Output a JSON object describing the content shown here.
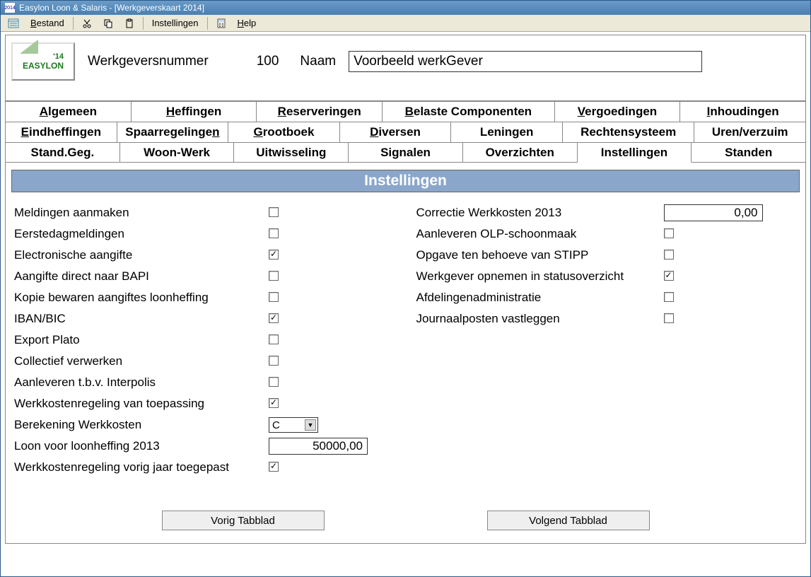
{
  "title": "Easylon Loon & Salaris - [Werkgeverskaart 2014]",
  "menu": {
    "bestand": "Bestand",
    "instellingen": "Instellingen",
    "help": "Help"
  },
  "logo": {
    "line1": "'14",
    "line2": "EASYLON"
  },
  "header": {
    "werkgeversnummer_label": "Werkgeversnummer",
    "werkgeversnummer_value": "100",
    "naam_label": "Naam",
    "naam_value": "Voorbeeld werkGever"
  },
  "tabs": {
    "row1": [
      "Algemeen",
      "Heffingen",
      "Reserveringen",
      "Belaste Componenten",
      "Vergoedingen",
      "Inhoudingen"
    ],
    "row2": [
      "Eindheffingen",
      "Spaarregelingen",
      "Grootboek",
      "Diversen",
      "Leningen",
      "Rechtensysteem",
      "Uren/verzuim"
    ],
    "row3": [
      "Stand.Geg.",
      "Woon-Werk",
      "Uitwisseling",
      "Signalen",
      "Overzichten",
      "Instellingen",
      "Standen"
    ]
  },
  "section_title": "Instellingen",
  "left": [
    {
      "label": "Meldingen aanmaken",
      "type": "check",
      "checked": false
    },
    {
      "label": "Eerstedagmeldingen",
      "type": "check",
      "checked": false
    },
    {
      "label": "Electronische aangifte",
      "type": "check",
      "checked": true
    },
    {
      "label": "Aangifte direct naar BAPI",
      "type": "check",
      "checked": false
    },
    {
      "label": "Kopie bewaren aangiftes loonheffing",
      "type": "check",
      "checked": false
    },
    {
      "label": "IBAN/BIC",
      "type": "check",
      "checked": true
    },
    {
      "label": "Export Plato",
      "type": "check",
      "checked": false
    },
    {
      "label": "Collectief verwerken",
      "type": "check",
      "checked": false
    },
    {
      "label": "Aanleveren t.b.v. Interpolis",
      "type": "check",
      "checked": false
    },
    {
      "label": "Werkkostenregeling van toepassing",
      "type": "check",
      "checked": true
    },
    {
      "label": "Berekening Werkkosten",
      "type": "select",
      "value": "C"
    },
    {
      "label": "Loon voor loonheffing 2013",
      "type": "number",
      "value": "50000,00"
    },
    {
      "label": "Werkkostenregeling vorig jaar toegepast",
      "type": "check",
      "checked": true
    }
  ],
  "right": [
    {
      "label": "Correctie Werkkosten 2013",
      "type": "number",
      "value": "0,00"
    },
    {
      "label": "Aanleveren OLP-schoonmaak",
      "type": "check",
      "checked": false
    },
    {
      "label": "Opgave ten behoeve van STIPP",
      "type": "check",
      "checked": false
    },
    {
      "label": "Werkgever opnemen in statusoverzicht",
      "type": "check",
      "checked": true
    },
    {
      "label": "Afdelingenadministratie",
      "type": "check",
      "checked": false
    },
    {
      "label": "Journaalposten vastleggen",
      "type": "check",
      "checked": false
    }
  ],
  "buttons": {
    "prev": "Vorig Tabblad",
    "next": "Volgend Tabblad"
  }
}
